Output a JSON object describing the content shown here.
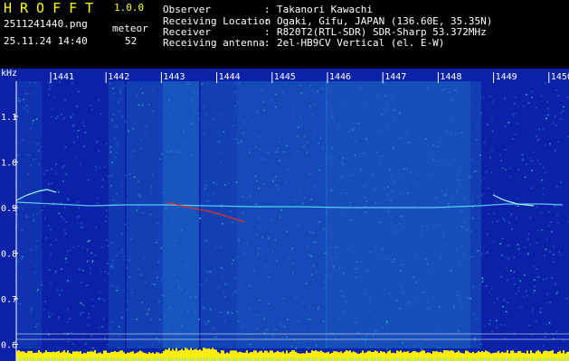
{
  "header": {
    "app_title": "HROFFT",
    "app_version": "1.0.0",
    "file_name": "2511241440.png",
    "timestamp": "25.11.24 14:40",
    "meteor_label": "meteor",
    "meteor_count": "52",
    "info": [
      {
        "key": "Observer",
        "value": "Takanori Kawachi"
      },
      {
        "key": "Receiving Location",
        "value": "Ogaki, Gifu, JAPAN (136.60E, 35.35N)"
      },
      {
        "key": "Receiver",
        "value": "R820T2(RTL-SDR) SDR-Sharp 53.372MHz"
      },
      {
        "key": "Receiving antenna",
        "value": "2el-HB9CV Vertical (el. E-W)"
      }
    ]
  },
  "spectrogram": {
    "y_unit": "kHz",
    "y_ticks": [
      "1.1",
      "1.0",
      "0.9",
      "0.8",
      "0.7",
      "0.6"
    ],
    "x_ticks": [
      "1441",
      "1442",
      "1443",
      "1444",
      "1445",
      "1446",
      "1447",
      "1448",
      "1449",
      "1450"
    ],
    "colors": {
      "background": "#0b22a8",
      "noise_mid": "#1f6fc8",
      "noise_high": "#2fd0b0",
      "echo": "#e03020",
      "carrier": "#66e0ff",
      "baseline": "#ffee00",
      "label": "#ffffff"
    }
  }
}
